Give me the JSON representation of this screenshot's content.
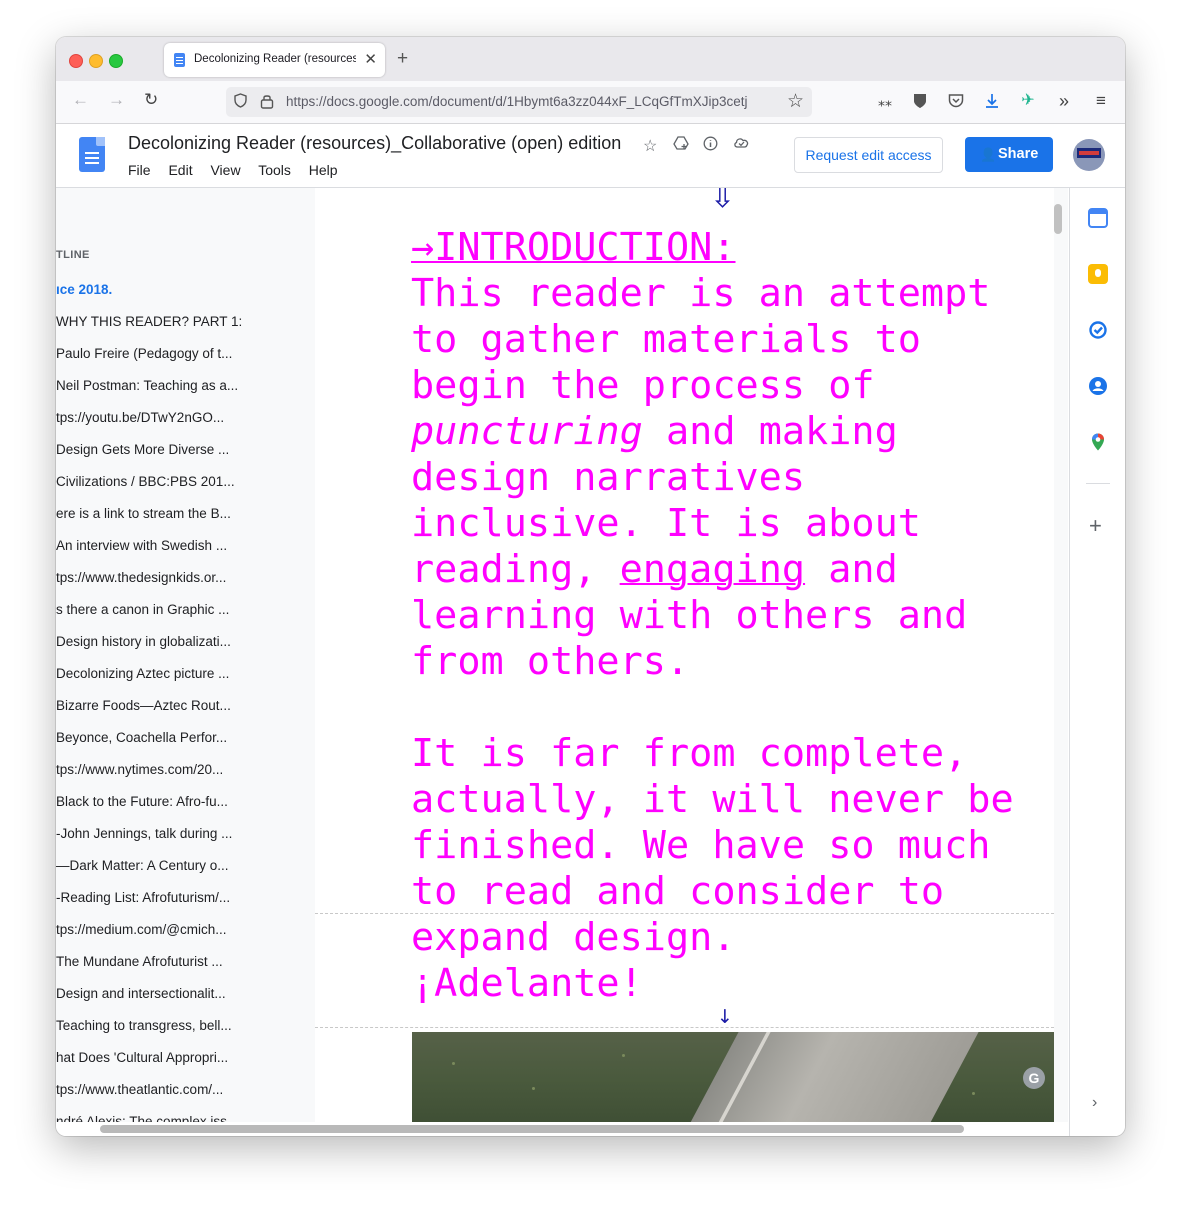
{
  "browser": {
    "tab_title": "Decolonizing Reader (resources)_Collaborative (open) edition",
    "tab_close": "✕",
    "new_tab": "+",
    "url": "https://docs.google.com/document/d/1Hbymt6a3zz044xF_LCqGfTmXJip3cetj",
    "nav": {
      "back": "←",
      "forward": "→",
      "reload": "↻"
    },
    "toolbar_icons": [
      "extensions-icon",
      "bitwarden-icon",
      "pocket-icon",
      "download-icon",
      "extension-bird-icon",
      "overflow-icon",
      "menu-icon"
    ]
  },
  "docs": {
    "title": "Decolonizing Reader (resources)_Collaborative (open) edition",
    "menu": [
      "File",
      "Edit",
      "View",
      "Tools",
      "Help"
    ],
    "request_edit_label": "Request edit access",
    "share_label": "Share"
  },
  "outline": {
    "heading": "TLINE",
    "items": [
      {
        "label": "ıce 2018.",
        "active": true
      },
      {
        "label": "WHY THIS READER? PART 1:"
      },
      {
        "label": "Paulo Freire (Pedagogy of t..."
      },
      {
        "label": "Neil Postman: Teaching as a..."
      },
      {
        "label": "tps://youtu.be/DTwY2nGO..."
      },
      {
        "label": "Design Gets More Diverse ..."
      },
      {
        "label": "Civilizations / BBC:PBS 201..."
      },
      {
        "label": "ere is a link to stream the B..."
      },
      {
        "label": "An interview with Swedish ..."
      },
      {
        "label": "tps://www.thedesignkids.or..."
      },
      {
        "label": "s there a canon in Graphic ..."
      },
      {
        "label": "Design history in globalizati..."
      },
      {
        "label": "Decolonizing Aztec picture ..."
      },
      {
        "label": "Bizarre Foods—Aztec Rout..."
      },
      {
        "label": "Beyonce, Coachella Perfor..."
      },
      {
        "label": "tps://www.nytimes.com/20..."
      },
      {
        "label": "Black to the Future: Afro-fu..."
      },
      {
        "label": "-John Jennings, talk during ..."
      },
      {
        "label": "—Dark Matter: A Century o..."
      },
      {
        "label": "-Reading List: Afrofuturism/..."
      },
      {
        "label": "tps://medium.com/@cmich..."
      },
      {
        "label": "The Mundane Afrofuturist ..."
      },
      {
        "label": "Design and intersectionalit..."
      },
      {
        "label": "Teaching to transgress, bell..."
      },
      {
        "label": "hat Does 'Cultural Appropri..."
      },
      {
        "label": "tps://www.theatlantic.com/..."
      },
      {
        "label": "ndré Alexis: The complex iss..."
      }
    ]
  },
  "document": {
    "arrow_top": "⇩",
    "heading": "→INTRODUCTION:",
    "para1": {
      "l1": "This reader is an attempt",
      "l2": "to gather materials to",
      "l3": "begin the process of",
      "l4_italic": "puncturing",
      "l4_rest": " and making",
      "l5": "design narratives",
      "l6": "inclusive. It is about",
      "l7_pre": "reading, ",
      "l7_underlined": "engaging",
      "l7_post": " and",
      "l8": "learning with others and",
      "l9": "from others."
    },
    "para2": {
      "l1": "It is far from complete,",
      "l2": "actually, it will never be",
      "l3": "finished. We have so much",
      "l4": "to read and consider to",
      "l5": "expand design.",
      "l6": "¡Adelante!"
    },
    "arrow_bottom": "↓",
    "grammarly_badge": "G"
  },
  "colors": {
    "text_accent": "#ff00ff",
    "arrow": "#1a1aa6",
    "share_button": "#1a73e8"
  }
}
